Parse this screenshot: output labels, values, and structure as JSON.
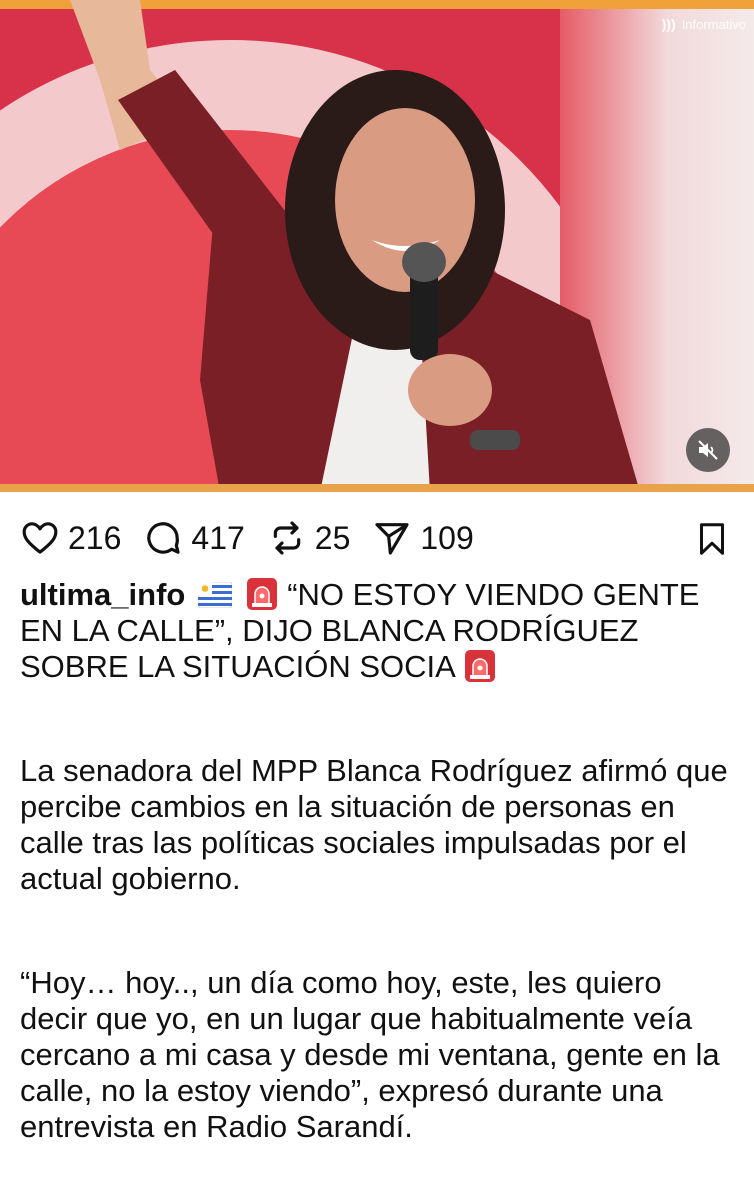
{
  "video": {
    "brand_label": "Informativo",
    "mute_icon": "speaker-muted-icon"
  },
  "actions": {
    "likes": "216",
    "comments": "417",
    "reposts": "25",
    "shares": "109",
    "icons": [
      "heart-icon",
      "comment-icon",
      "repost-icon",
      "send-icon",
      "bookmark-icon"
    ]
  },
  "post": {
    "username": "ultima_info",
    "headline": "“NO ESTOY VIENDO GENTE EN LA CALLE”, DIJO BLANCA RODRÍGUEZ SOBRE LA SITUACIÓN SOCIA",
    "paragraph1": "La senadora del MPP Blanca Rodríguez afirmó que percibe cambios en la situación de personas en calle tras las políticas sociales impulsadas por el actual gobierno.",
    "paragraph2": "“Hoy… hoy.., un día como hoy, este, les quiero decir que yo, en un lugar que habitualmente veía cercano a mi casa y desde mi ventana, gente en la calle, no la estoy viendo”, expresó durante una entrevista en Radio Sarandí."
  },
  "colors": {
    "stage_red": "#e84a55",
    "jacket": "#7a1f26",
    "accent_strip": "#f0a13a"
  }
}
